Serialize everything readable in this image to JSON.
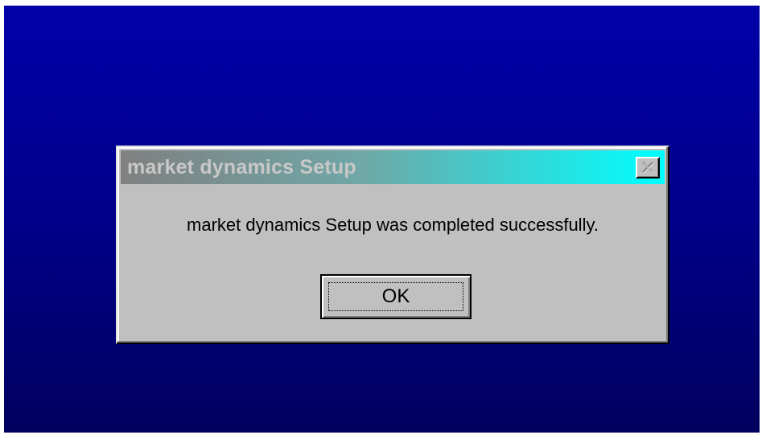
{
  "dialog": {
    "title": "market dynamics Setup",
    "message": "market dynamics Setup was completed successfully.",
    "ok_label": "OK",
    "close_icon": "close-icon"
  },
  "colors": {
    "desktop_top": "#0000a8",
    "desktop_bottom": "#00005e",
    "dialog_face": "#c0c0c0",
    "title_gradient_start": "#808080",
    "title_gradient_end": "#00ffff"
  }
}
